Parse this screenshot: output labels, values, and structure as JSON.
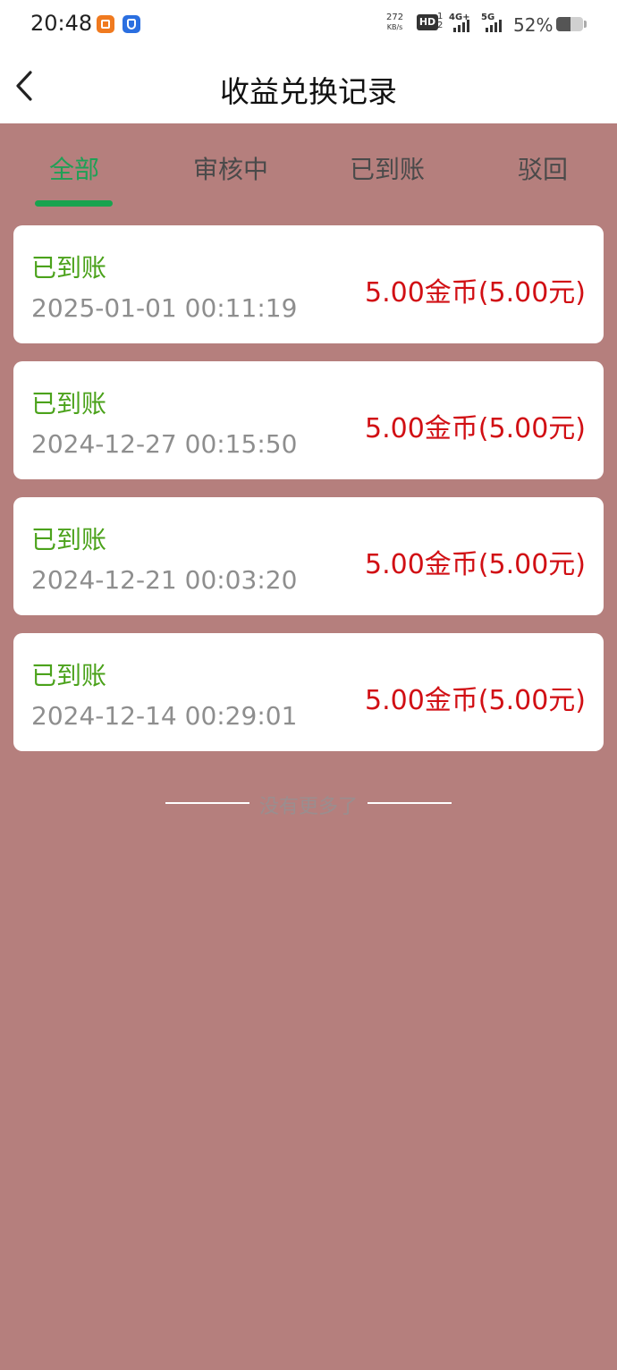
{
  "status_bar": {
    "time": "20:48",
    "net_speed_value": "272",
    "net_speed_unit": "KB/s",
    "hd_label": "HD",
    "hd_sub": "1 2",
    "sim1_label": "4G+",
    "sim2_label": "5G",
    "battery_pct": "52%",
    "battery_level": 0.52
  },
  "header": {
    "back_icon": "chevron-left-icon",
    "title": "收益兑换记录"
  },
  "tabs": [
    {
      "label": "全部",
      "active": true
    },
    {
      "label": "审核中",
      "active": false
    },
    {
      "label": "已到账",
      "active": false
    },
    {
      "label": "驳回",
      "active": false
    }
  ],
  "records": [
    {
      "status": "已到账",
      "date": "2025-01-01 00:11:19",
      "amount": "5.00金币(5.00元)"
    },
    {
      "status": "已到账",
      "date": "2024-12-27 00:15:50",
      "amount": "5.00金币(5.00元)"
    },
    {
      "status": "已到账",
      "date": "2024-12-21 00:03:20",
      "amount": "5.00金币(5.00元)"
    },
    {
      "status": "已到账",
      "date": "2024-12-14 00:29:01",
      "amount": "5.00金币(5.00元)"
    }
  ],
  "footer": {
    "no_more": "没有更多了"
  },
  "colors": {
    "background": "#b57f7d",
    "active_tab": "#1fa056",
    "status_green": "#4ba21b",
    "amount_red": "#d10f14"
  }
}
